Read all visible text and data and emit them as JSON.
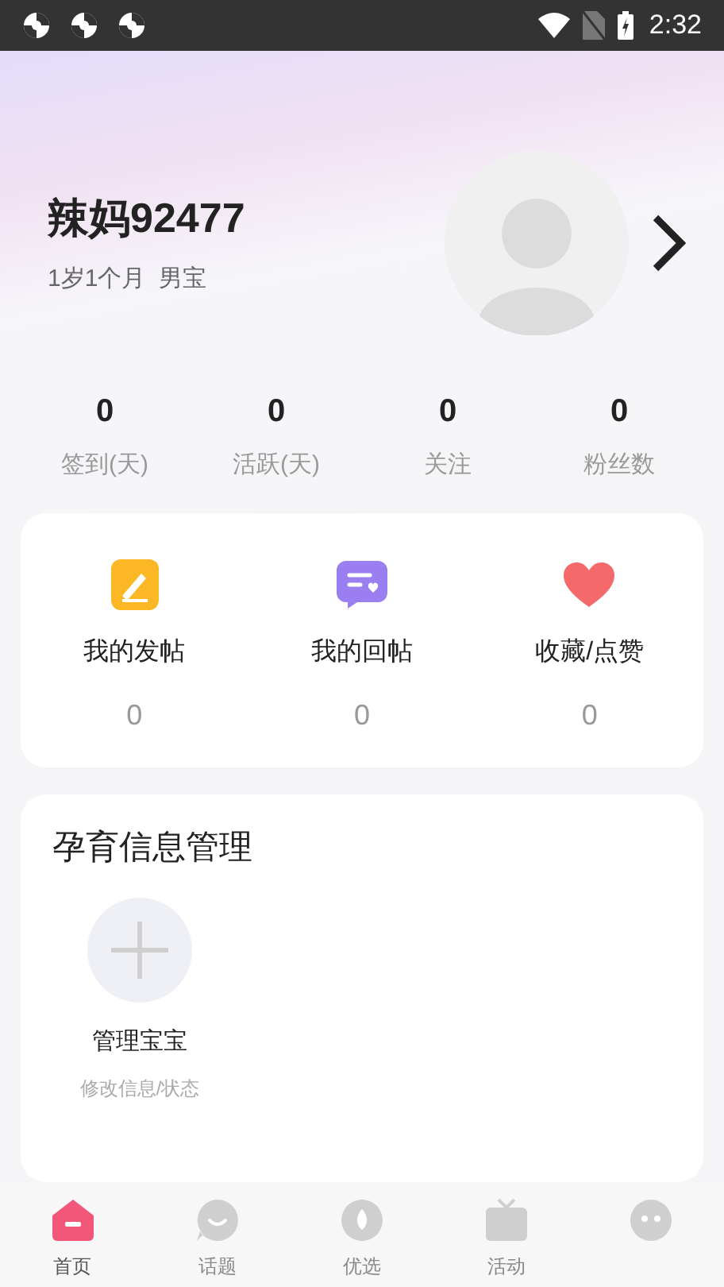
{
  "status_bar": {
    "time": "2:32"
  },
  "profile": {
    "name": "辣妈92477",
    "subtitle": "1岁1个月  男宝"
  },
  "stats": [
    {
      "value": "0",
      "label": "签到(天)"
    },
    {
      "value": "0",
      "label": "活跃(天)"
    },
    {
      "value": "0",
      "label": "关注"
    },
    {
      "value": "0",
      "label": "粉丝数"
    }
  ],
  "my_items": [
    {
      "kind": "post",
      "label": "我的发帖",
      "count": "0"
    },
    {
      "kind": "reply",
      "label": "我的回帖",
      "count": "0"
    },
    {
      "kind": "favorite",
      "label": "收藏/点赞",
      "count": "0"
    }
  ],
  "pregnancy_section": {
    "title": "孕育信息管理",
    "action": {
      "label": "管理宝宝",
      "hint": "修改信息/状态"
    }
  },
  "bottom_nav": [
    {
      "kind": "home",
      "label": "首页",
      "selected": true
    },
    {
      "kind": "topic",
      "label": "话题",
      "selected": false
    },
    {
      "kind": "select",
      "label": "优选",
      "selected": false
    },
    {
      "kind": "event",
      "label": "活动",
      "selected": false
    },
    {
      "kind": "me",
      "selected": false
    }
  ]
}
